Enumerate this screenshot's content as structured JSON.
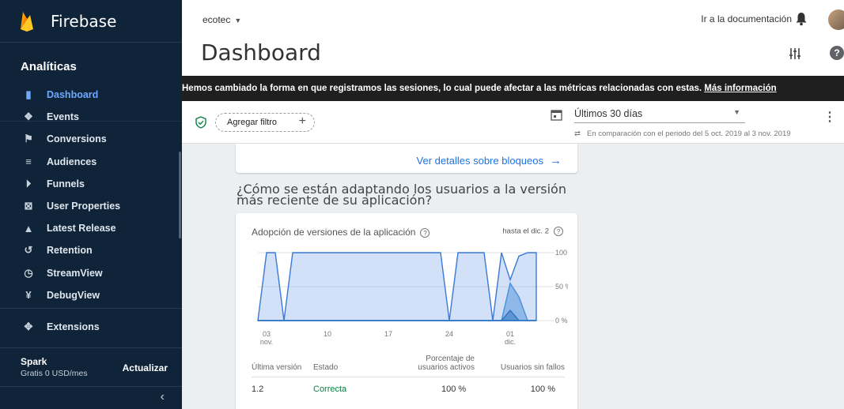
{
  "brand": {
    "name": "Firebase",
    "section": "Analíticas"
  },
  "sidebar": {
    "items": [
      {
        "label": "Dashboard",
        "icon": "bar-chart-icon",
        "active": true
      },
      {
        "label": "Events",
        "icon": "events-icon",
        "active": false
      },
      {
        "label": "Conversions",
        "icon": "flag-icon",
        "active": false
      },
      {
        "label": "Audiences",
        "icon": "audiences-icon",
        "active": false
      },
      {
        "label": "Funnels",
        "icon": "funnel-icon",
        "active": false
      },
      {
        "label": "User Properties",
        "icon": "user-properties-icon",
        "active": false
      },
      {
        "label": "Latest Release",
        "icon": "latest-release-icon",
        "active": false
      },
      {
        "label": "Retention",
        "icon": "retention-icon",
        "active": false
      },
      {
        "label": "StreamView",
        "icon": "clock-icon",
        "active": false
      },
      {
        "label": "DebugView",
        "icon": "debug-icon",
        "active": false
      }
    ],
    "extensions": "Extensions",
    "plan": "Spark",
    "price": "Gratis 0 USD/mes",
    "upgrade": "Actualizar",
    "collapse": "‹"
  },
  "header": {
    "project": "ecotec",
    "docs": "Ir a la documentación",
    "title": "Dashboard"
  },
  "banner": {
    "text": "Hemos cambiado la forma en que registramos las sesiones, lo cual puede afectar a las métricas relacionadas con estas. ",
    "link": "Más información"
  },
  "filter": {
    "add": "Agregar filtro",
    "range": "Últimos 30 días",
    "compare": "En comparación con el periodo del 5 oct. 2019 al 3 nov. 2019"
  },
  "blocks": {
    "link": "Ver detalles sobre bloqueos"
  },
  "question": "¿Cómo se están adaptando los usuarios a la versión más reciente de su aplicación?",
  "adoption": {
    "title": "Adopción de versiones de la aplicación",
    "until": "hasta el dic. 2",
    "columns": [
      "Última versión",
      "Estado",
      "Porcentaje de usuarios activos",
      "Usuarios sin fallos"
    ],
    "row": {
      "version": "1.2",
      "status": "Correcta",
      "active": "100 %",
      "crashfree": "100 %"
    }
  },
  "colors": {
    "accent": "#1a73e8",
    "sidebar": "#0f2438",
    "active_nav": "#6ea8ff",
    "ok": "#0a8043"
  },
  "chart_data": {
    "type": "area",
    "title": "Adopción de versiones de la aplicación",
    "x": [
      0,
      1,
      2,
      3,
      4,
      5,
      6,
      7,
      8,
      9,
      10,
      11,
      12,
      13,
      14,
      15,
      16,
      17,
      18,
      19,
      20,
      21,
      22,
      23,
      24,
      25,
      26,
      27,
      28,
      29,
      30
    ],
    "x_ticks": [
      {
        "x": 1,
        "label": "03",
        "sub": "nov."
      },
      {
        "x": 8,
        "label": "10"
      },
      {
        "x": 15,
        "label": "17"
      },
      {
        "x": 22,
        "label": "24"
      },
      {
        "x": 29,
        "label": "01",
        "sub": "dic."
      }
    ],
    "y_ticks": [
      "100 %",
      "50 %",
      "0 %"
    ],
    "ylim": [
      0,
      100
    ],
    "series": [
      {
        "values": [
          0,
          100,
          100,
          0,
          100,
          100,
          100,
          100,
          100,
          100,
          100,
          100,
          100,
          100,
          100,
          100,
          100,
          100,
          100,
          100,
          100,
          100,
          0,
          100,
          100,
          100,
          100,
          0,
          100,
          60,
          95,
          100,
          100
        ],
        "color": "#7ea8e8"
      },
      {
        "values": [
          0,
          0,
          0,
          0,
          0,
          0,
          0,
          0,
          0,
          0,
          0,
          0,
          0,
          0,
          0,
          0,
          0,
          0,
          0,
          0,
          0,
          0,
          0,
          0,
          0,
          0,
          0,
          0,
          0,
          55,
          35,
          0,
          0
        ],
        "color": "#4a90d9"
      },
      {
        "values": [
          0,
          0,
          0,
          0,
          0,
          0,
          0,
          0,
          0,
          0,
          0,
          0,
          0,
          0,
          0,
          0,
          0,
          0,
          0,
          0,
          0,
          0,
          0,
          0,
          0,
          0,
          0,
          0,
          0,
          15,
          0,
          0,
          0
        ],
        "color": "#2f74c0"
      }
    ]
  }
}
